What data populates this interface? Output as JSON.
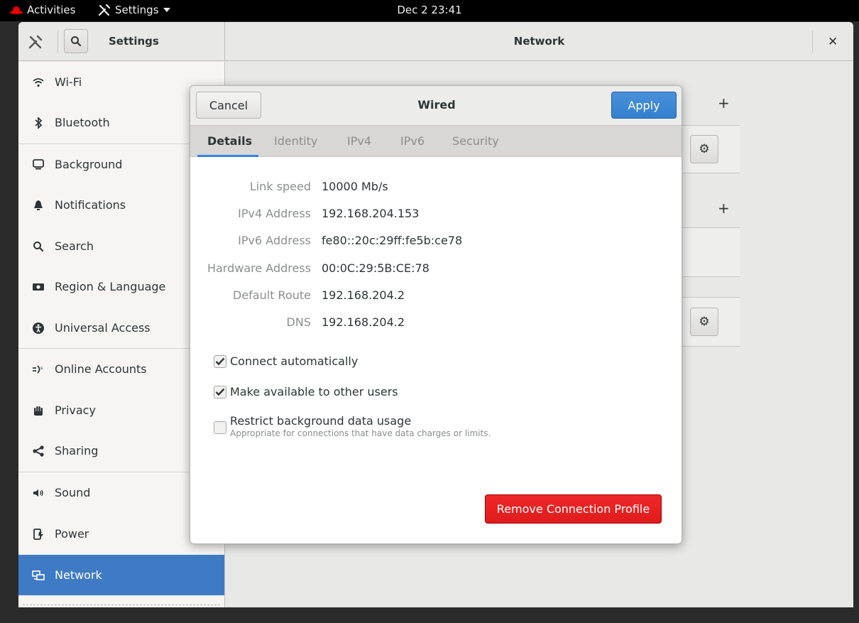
{
  "topbar": {
    "activities": "Activities",
    "app_menu": "Settings",
    "clock": "Dec 2  23:41"
  },
  "header": {
    "left_title": "Settings",
    "title": "Network"
  },
  "sidebar": {
    "items": [
      {
        "label": "Wi-Fi",
        "icon": "wifi-icon"
      },
      {
        "label": "Bluetooth",
        "icon": "bluetooth-icon"
      },
      {
        "label": "Background",
        "icon": "background-icon"
      },
      {
        "label": "Notifications",
        "icon": "bell-icon"
      },
      {
        "label": "Search",
        "icon": "search-icon"
      },
      {
        "label": "Region & Language",
        "icon": "region-icon"
      },
      {
        "label": "Universal Access",
        "icon": "accessibility-icon"
      },
      {
        "label": "Online Accounts",
        "icon": "online-accounts-icon"
      },
      {
        "label": "Privacy",
        "icon": "hand-icon"
      },
      {
        "label": "Sharing",
        "icon": "share-icon"
      },
      {
        "label": "Sound",
        "icon": "speaker-icon"
      },
      {
        "label": "Power",
        "icon": "power-icon"
      },
      {
        "label": "Network",
        "icon": "network-icon",
        "selected": true
      }
    ]
  },
  "dialog": {
    "title": "Wired",
    "cancel_label": "Cancel",
    "apply_label": "Apply",
    "tabs": [
      {
        "label": "Details",
        "active": true
      },
      {
        "label": "Identity"
      },
      {
        "label": "IPv4"
      },
      {
        "label": "IPv6"
      },
      {
        "label": "Security"
      }
    ],
    "details": [
      {
        "label": "Link speed",
        "value": "10000 Mb/s"
      },
      {
        "label": "IPv4 Address",
        "value": "192.168.204.153"
      },
      {
        "label": "IPv6 Address",
        "value": "fe80::20c:29ff:fe5b:ce78"
      },
      {
        "label": "Hardware Address",
        "value": "00:0C:29:5B:CE:78"
      },
      {
        "label": "Default Route",
        "value": "192.168.204.2"
      },
      {
        "label": "DNS",
        "value": "192.168.204.2"
      }
    ],
    "options": [
      {
        "label": "Connect automatically",
        "checked": true
      },
      {
        "label": "Make available to other users",
        "checked": true
      },
      {
        "label": "Restrict background data usage",
        "checked": false,
        "sublabel": "Appropriate for connections that have data charges or limits."
      }
    ],
    "remove_label": "Remove Connection Profile"
  },
  "colors": {
    "accent": "#3584e4",
    "selected_bg": "#3e7bc4",
    "destructive": "#e01b1b"
  }
}
